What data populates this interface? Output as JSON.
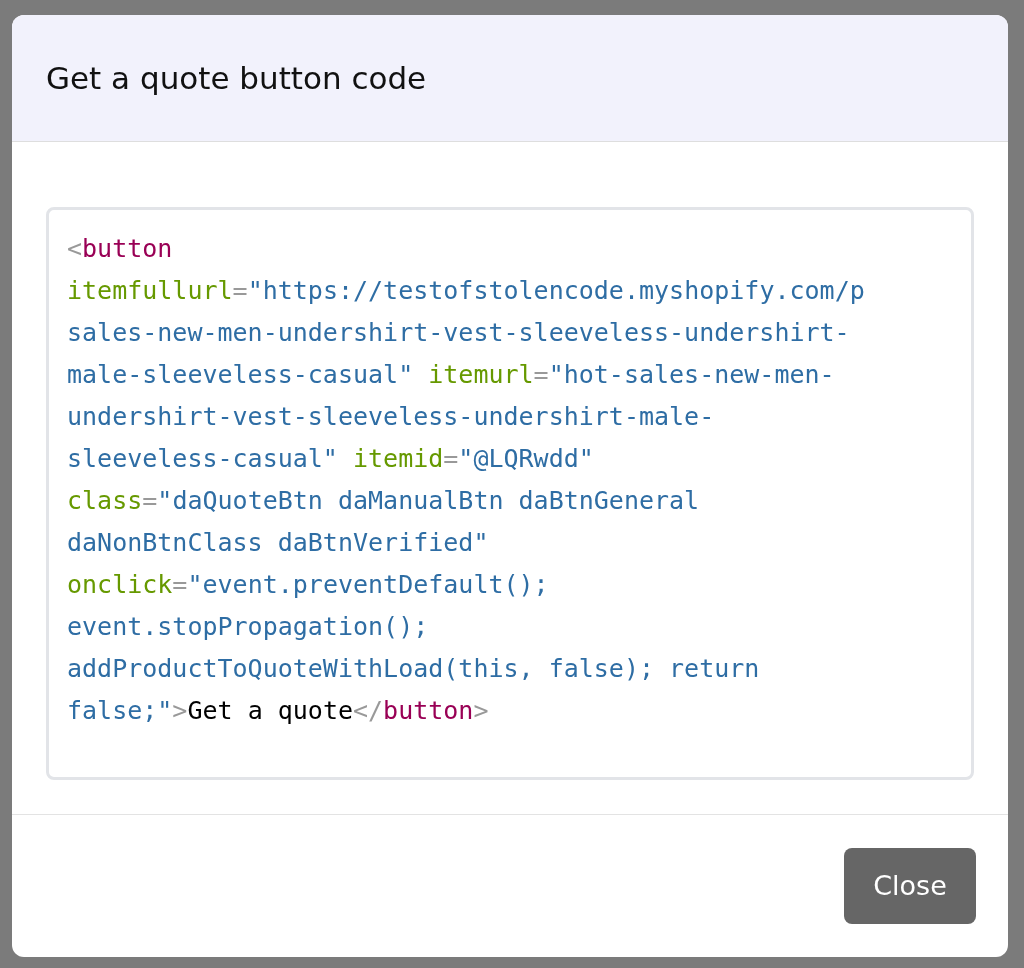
{
  "dialog": {
    "title": "Get a quote button code",
    "code_lines": [
      [
        {
          "kind": "punct",
          "text": "<"
        },
        {
          "kind": "tag",
          "text": "button"
        }
      ],
      [
        {
          "kind": "attr",
          "text": "itemfullurl"
        },
        {
          "kind": "punct",
          "text": "="
        },
        {
          "kind": "string",
          "text": "\"https://testofstolencode.myshopify.com/p"
        }
      ],
      [
        {
          "kind": "string",
          "text": "sales-new-men-undershirt-vest-sleeveless-undershirt-"
        }
      ],
      [
        {
          "kind": "string",
          "text": "male-sleeveless-casual\" "
        },
        {
          "kind": "attr",
          "text": "itemurl"
        },
        {
          "kind": "punct",
          "text": "="
        },
        {
          "kind": "string",
          "text": "\"hot-sales-new-men-"
        }
      ],
      [
        {
          "kind": "string",
          "text": "undershirt-vest-sleeveless-undershirt-male-"
        }
      ],
      [
        {
          "kind": "string",
          "text": "sleeveless-casual\" "
        },
        {
          "kind": "attr",
          "text": "itemid"
        },
        {
          "kind": "punct",
          "text": "="
        },
        {
          "kind": "string",
          "text": "\"@LQRwdd\""
        }
      ],
      [
        {
          "kind": "attr",
          "text": "class"
        },
        {
          "kind": "punct",
          "text": "="
        },
        {
          "kind": "string",
          "text": "\"daQuoteBtn daManualBtn daBtnGeneral"
        }
      ],
      [
        {
          "kind": "string",
          "text": "daNonBtnClass daBtnVerified\""
        }
      ],
      [
        {
          "kind": "attr",
          "text": "onclick"
        },
        {
          "kind": "punct",
          "text": "="
        },
        {
          "kind": "string",
          "text": "\"event.preventDefault();"
        }
      ],
      [
        {
          "kind": "string",
          "text": "event.stopPropagation();"
        }
      ],
      [
        {
          "kind": "string",
          "text": "addProductToQuoteWithLoad(this, false); return"
        }
      ],
      [
        {
          "kind": "string",
          "text": "false;\""
        },
        {
          "kind": "punct",
          "text": ">"
        },
        {
          "kind": "text",
          "text": "Get a quote"
        },
        {
          "kind": "punct",
          "text": "</"
        },
        {
          "kind": "tag",
          "text": "button"
        },
        {
          "kind": "punct",
          "text": ">"
        }
      ]
    ],
    "close_button": "Close"
  }
}
